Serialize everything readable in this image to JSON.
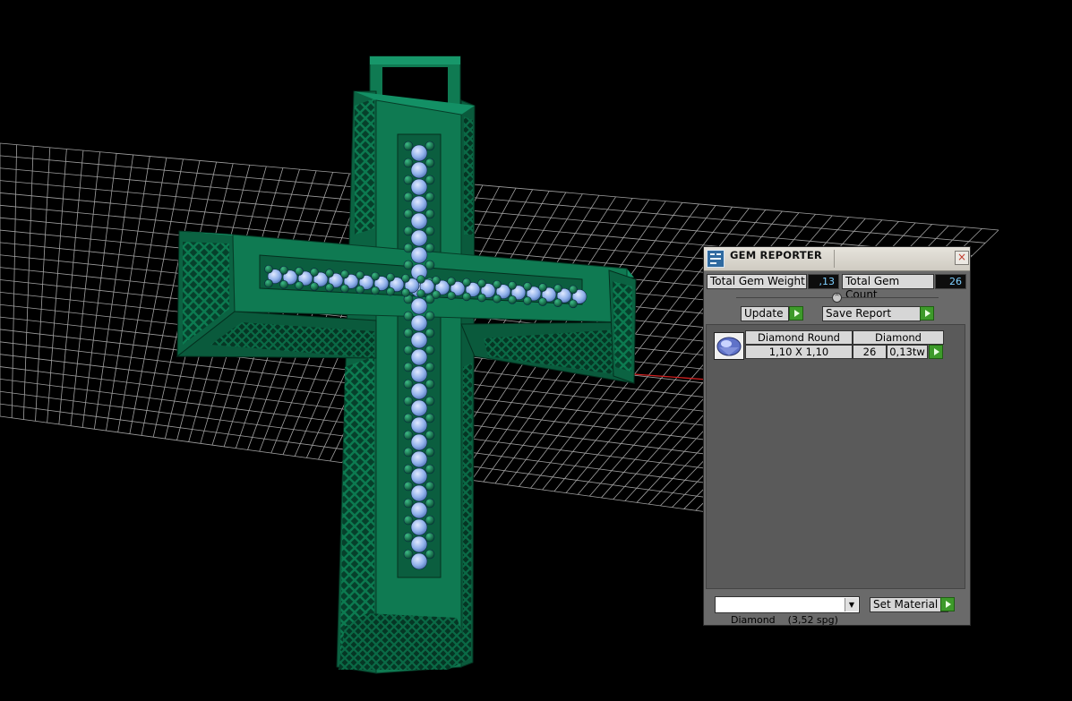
{
  "panel": {
    "title": "GEM REPORTER",
    "close_glyph": "×",
    "total_weight_label": "Total Gem Weight",
    "total_weight_value": ",13",
    "total_count_label": "Total Gem Count",
    "total_count_value": "26",
    "update_label": "Update",
    "save_report_label": "Save Report",
    "divider_glyph": "^",
    "gems": [
      {
        "name": "Diamond Round",
        "size": "1,10 X 1,10",
        "material": "Diamond",
        "count": "26",
        "weight": "0,13tw"
      }
    ],
    "material_select": "Diamond    (3,52 spg)",
    "select_arrow": "▼",
    "set_material_label": "Set Material"
  },
  "icons": {
    "title": "gem-reporter-icon",
    "gem_thumb": "round-diamond-icon",
    "go": "green-play-arrow-icon"
  },
  "colors": {
    "metal": "#0f7a52",
    "gem": "#8fb0ea",
    "grid": "#bdbdbd",
    "background": "#000000",
    "value_text": "#7fd0ff",
    "go_button": "#3d9a2a"
  }
}
